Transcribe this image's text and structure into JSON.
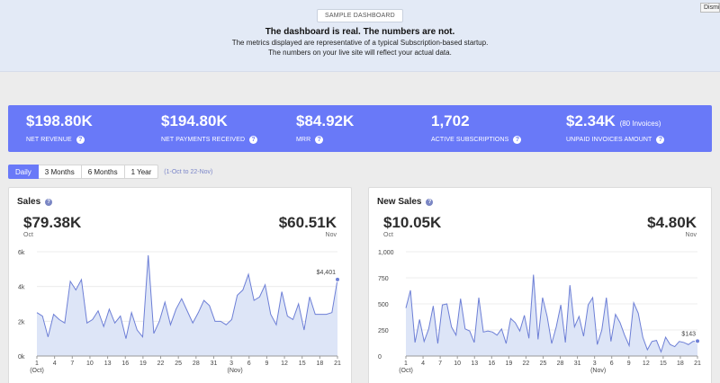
{
  "banner": {
    "tag": "SAMPLE DASHBOARD",
    "headline": "The dashboard is real. The numbers are not.",
    "line1": "The metrics displayed are representative of a typical Subscription-based startup.",
    "line2": "The numbers on your live site will reflect your actual data.",
    "dismiss": "Dismiss"
  },
  "metrics": [
    {
      "value": "$198.80K",
      "extra": "",
      "label": "NET REVENUE"
    },
    {
      "value": "$194.80K",
      "extra": "",
      "label": "NET PAYMENTS RECEIVED"
    },
    {
      "value": "$84.92K",
      "extra": "",
      "label": "MRR"
    },
    {
      "value": "1,702",
      "extra": "",
      "label": "ACTIVE SUBSCRIPTIONS"
    },
    {
      "value": "$2.34K",
      "extra": "(80 Invoices)",
      "label": "UNPAID INVOICES AMOUNT"
    }
  ],
  "tabs": [
    "Daily",
    "3 Months",
    "6 Months",
    "1 Year"
  ],
  "active_tab": "Daily",
  "range": "(1-Oct to 22-Nov)",
  "colors": {
    "accent": "#6979f8",
    "fill": "#dde5f7",
    "line": "#6d7fd6"
  },
  "charts": {
    "sales": {
      "title": "Sales",
      "left_value": "$79.38K",
      "left_sub": "Oct",
      "right_value": "$60.51K",
      "right_sub": "Nov",
      "last_label": "$4,401"
    },
    "new_sales": {
      "title": "New Sales",
      "left_value": "$10.05K",
      "left_sub": "Oct",
      "right_value": "$4.80K",
      "right_sub": "Nov",
      "last_label": "$143"
    }
  },
  "chart_data": [
    {
      "type": "area",
      "title": "Sales",
      "ylim": [
        0,
        6000
      ],
      "yticks": [
        "0k",
        "2k",
        "4k",
        "6k"
      ],
      "xticks": [
        "1",
        "4",
        "7",
        "10",
        "13",
        "16",
        "19",
        "22",
        "25",
        "28",
        "31",
        "3",
        "6",
        "9",
        "12",
        "15",
        "18",
        "21"
      ],
      "xsub": [
        "(Oct)",
        "(Nov)"
      ],
      "values": [
        2500,
        2300,
        1100,
        2400,
        2100,
        1900,
        4300,
        3800,
        4400,
        1900,
        2100,
        2600,
        1700,
        2700,
        1900,
        2300,
        1000,
        2500,
        1500,
        1100,
        5800,
        1300,
        2000,
        3100,
        1800,
        2700,
        3300,
        2600,
        1900,
        2500,
        3200,
        2900,
        2000,
        2000,
        1800,
        2100,
        3500,
        3800,
        4700,
        3200,
        3400,
        4100,
        2400,
        1800,
        3700,
        2300,
        2100,
        3000,
        1500,
        3400,
        2400,
        2400,
        2400,
        2500,
        4401
      ],
      "last_label": "$4,401"
    },
    {
      "type": "area",
      "title": "New Sales",
      "ylim": [
        0,
        1000
      ],
      "yticks": [
        "0",
        "250",
        "500",
        "750",
        "1,000"
      ],
      "xticks": [
        "1",
        "4",
        "7",
        "10",
        "13",
        "16",
        "19",
        "22",
        "25",
        "28",
        "31",
        "3",
        "6",
        "9",
        "12",
        "15",
        "18",
        "21"
      ],
      "xsub": [
        "(Oct)",
        "(Nov)"
      ],
      "values": [
        460,
        630,
        130,
        350,
        140,
        260,
        480,
        120,
        490,
        500,
        280,
        200,
        550,
        260,
        240,
        130,
        560,
        230,
        240,
        230,
        200,
        260,
        120,
        360,
        320,
        240,
        390,
        170,
        780,
        160,
        560,
        380,
        120,
        280,
        490,
        130,
        680,
        280,
        380,
        190,
        490,
        560,
        110,
        250,
        560,
        140,
        400,
        320,
        200,
        100,
        510,
        410,
        180,
        60,
        140,
        150,
        40,
        180,
        110,
        90,
        140,
        130,
        110,
        140,
        143
      ],
      "last_label": "$143"
    }
  ]
}
